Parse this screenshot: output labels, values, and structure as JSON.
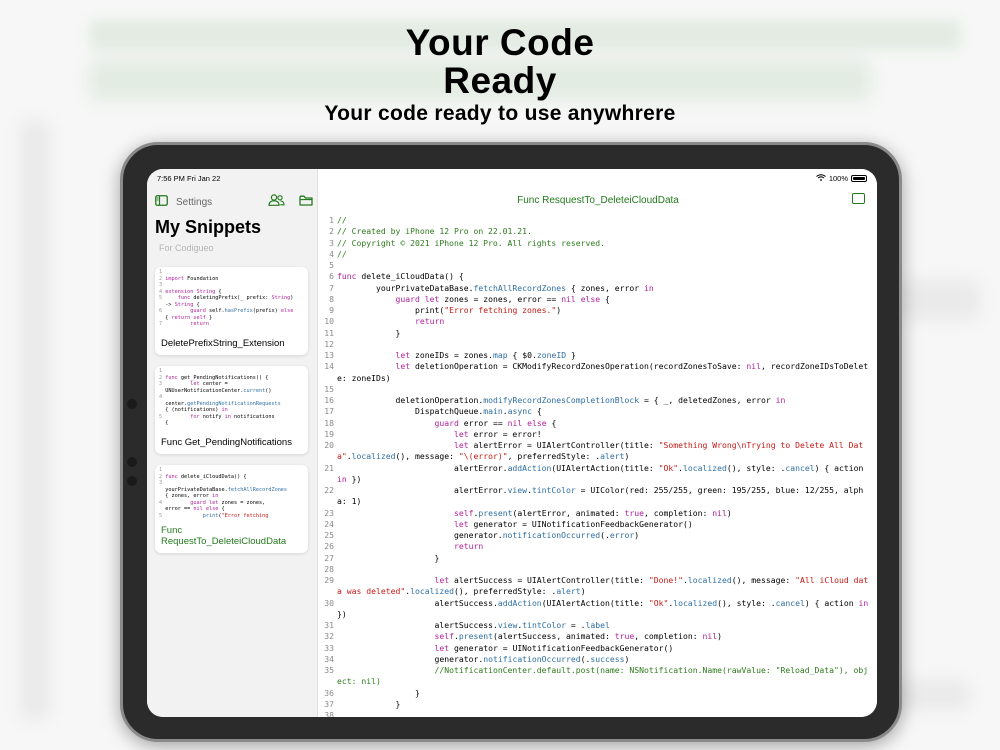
{
  "headline": {
    "title": "Your Code Ready",
    "subtitle": "Your code ready to use anywhrere"
  },
  "status_bar": {
    "time": "7:56 PM  Fri Jan 22",
    "battery": "100%"
  },
  "sidebar": {
    "settings_label": "Settings",
    "title": "My Snippets",
    "subtitle": "For Codigueo",
    "cards": [
      {
        "label": "DeletePrefixString_Extension",
        "lines": [
          "1",
          "2 import Foundation",
          "3",
          "4 extension String {",
          "5     func deletingPrefix(_ prefix: String)",
          "  -> String {",
          "6         guard self.hasPrefix(prefix) else",
          "  { return self }",
          "7         return"
        ]
      },
      {
        "label": "Func Get_PendingNotifications",
        "lines": [
          "1",
          "2 func get_PendingNotifications() {",
          "3         let center =",
          "  UNUserNotificationCenter.current()",
          "4",
          "  center.getPendingNotificationRequests",
          "  { (notifications) in",
          "5         for notify in notifications",
          "  {"
        ]
      },
      {
        "label": "Func RequestTo_DeleteiCloudData",
        "lines": [
          "1",
          "2 func delete_iCloudData() {",
          "3",
          "  yourPrivateDataBase.fetchAllRecordZones",
          "  { zones, error in",
          "4         guard let zones = zones,",
          "  error == nil else {",
          "5             print(\"Error fetching"
        ]
      }
    ]
  },
  "main": {
    "title": "Func ResquestTo_DeleteiCloudData",
    "code_lines": [
      "//",
      "// Created by iPhone 12 Pro on 22.01.21.",
      "// Copyright © 2021 iPhone 12 Pro. All rights reserved.",
      "//",
      "",
      "func delete_iCloudData() {",
      "        yourPrivateDataBase.fetchAllRecordZones { zones, error in",
      "            guard let zones = zones, error == nil else {",
      "                print(\"Error fetching zones.\")",
      "                return",
      "            }",
      "",
      "            let zoneIDs = zones.map { $0.zoneID }",
      "            let deletionOperation = CKModifyRecordZonesOperation(recordZonesToSave: nil, recordZoneIDsToDelete: zoneIDs)",
      "",
      "            deletionOperation.modifyRecordZonesCompletionBlock = { _, deletedZones, error in",
      "                DispatchQueue.main.async {",
      "                    guard error == nil else {",
      "                        let error = error!",
      "                        let alertError = UIAlertController(title: \"Something Wrong\\nTrying to Delete All Data\".localized(), message: \"\\(error)\", preferredStyle: .alert)",
      "                        alertError.addAction(UIAlertAction(title: \"Ok\".localized(), style: .cancel) { action in })",
      "                        alertError.view.tintColor = UIColor(red: 255/255, green: 195/255, blue: 12/255, alpha: 1)",
      "                        self.present(alertError, animated: true, completion: nil)",
      "                        let generator = UINotificationFeedbackGenerator()",
      "                        generator.notificationOccurred(.error)",
      "                        return",
      "                    }",
      "",
      "                    let alertSuccess = UIAlertController(title: \"Done!\".localized(), message: \"All iCloud data was deleted\".localized(), preferredStyle: .alert)",
      "                    alertSuccess.addAction(UIAlertAction(title: \"Ok\".localized(), style: .cancel) { action in })",
      "                    alertSuccess.view.tintColor = .label",
      "                    self.present(alertSuccess, animated: true, completion: nil)",
      "                    let generator = UINotificationFeedbackGenerator()",
      "                    generator.notificationOccurred(.success)",
      "                    //NotificationCenter.default.post(name: NSNotification.Name(rawValue: \"Reload_Data\"), object: nil)",
      "                }",
      "            }",
      ""
    ]
  },
  "colors": {
    "accent_green": "#237a1d",
    "keyword": "#b0229a",
    "function": "#2f6fa2",
    "string": "#c41a16",
    "comment": "#2d7a1c"
  }
}
